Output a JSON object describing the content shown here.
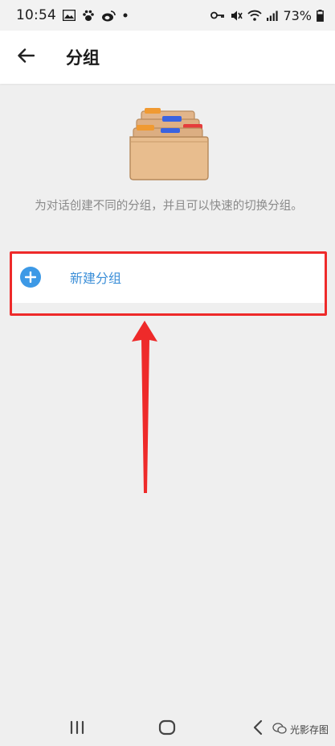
{
  "status_bar": {
    "time": "10:54",
    "battery": "73%",
    "icons": [
      "gallery-icon",
      "paw-icon",
      "weibo-icon",
      "dot-icon",
      "key-icon",
      "mute-icon",
      "wifi-icon",
      "signal-icon",
      "battery-icon"
    ]
  },
  "app_bar": {
    "back_icon": "arrow-left-icon",
    "title": "分组"
  },
  "illustration": {
    "icon": "folders-icon"
  },
  "description": "为对话创建不同的分组，并且可以快速的切换分组。",
  "new_group": {
    "icon": "plus-circle-icon",
    "label": "新建分组"
  },
  "annotation": {
    "highlight_color": "#ee2a2a"
  },
  "nav_bar": {
    "icons": [
      "recent-apps-icon",
      "home-icon",
      "back-icon"
    ]
  },
  "watermark": {
    "text": "光影存图"
  },
  "colors": {
    "accent": "#3d99e6",
    "label_blue": "#3c8fd8",
    "background": "#efefef"
  }
}
